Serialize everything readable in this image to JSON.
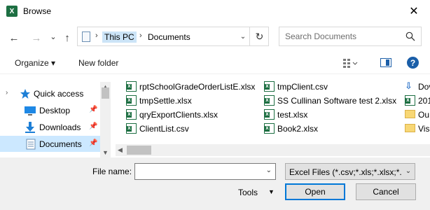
{
  "window": {
    "title": "Browse",
    "app_icon_letter": "X",
    "close_glyph": "✕"
  },
  "nav": {
    "back_glyph": "←",
    "forward_glyph": "→",
    "recent_glyph": "⌄",
    "up_glyph": "↑"
  },
  "address": {
    "crumbs": [
      "This PC",
      "Documents"
    ],
    "separator": "›",
    "dropdown_glyph": "⌄",
    "refresh_glyph": "↻"
  },
  "search": {
    "placeholder": "Search Documents"
  },
  "command_bar": {
    "organize": "Organize ▾",
    "new_folder": "New folder",
    "help": "?"
  },
  "nav_pane": {
    "items": [
      {
        "label": "Quick access",
        "icon": "star-icon",
        "expand": "›",
        "pinned": false,
        "selected": false
      },
      {
        "label": "Desktop",
        "icon": "desktop-icon",
        "pinned": true,
        "selected": false
      },
      {
        "label": "Downloads",
        "icon": "download-icon",
        "pinned": true,
        "selected": false
      },
      {
        "label": "Documents",
        "icon": "documents-icon",
        "pinned": true,
        "selected": true
      }
    ],
    "pin_glyph": "📌"
  },
  "files": {
    "col1": [
      "rptSchoolGradeOrderListE.xlsx",
      "tmpSettle.xlsx",
      "qryExportClients.xlsx",
      "ClientList.csv"
    ],
    "col2": [
      "tmpClient.csv",
      "SS Cullinan Software test 2.xlsx",
      "test.xlsx",
      "Book2.xlsx"
    ],
    "col3": [
      "Dov",
      "201",
      "Ou",
      "Vis"
    ]
  },
  "bottom": {
    "file_name_label": "File name:",
    "file_name_value": "",
    "filter": "Excel Files (*.csv;*.xls;*.xlsx;*.xlsm)",
    "tools": "Tools",
    "open": "Open",
    "cancel": "Cancel"
  },
  "colors": {
    "excel_green": "#1d6f42",
    "selection": "#cce8ff",
    "accent": "#0078d7"
  }
}
